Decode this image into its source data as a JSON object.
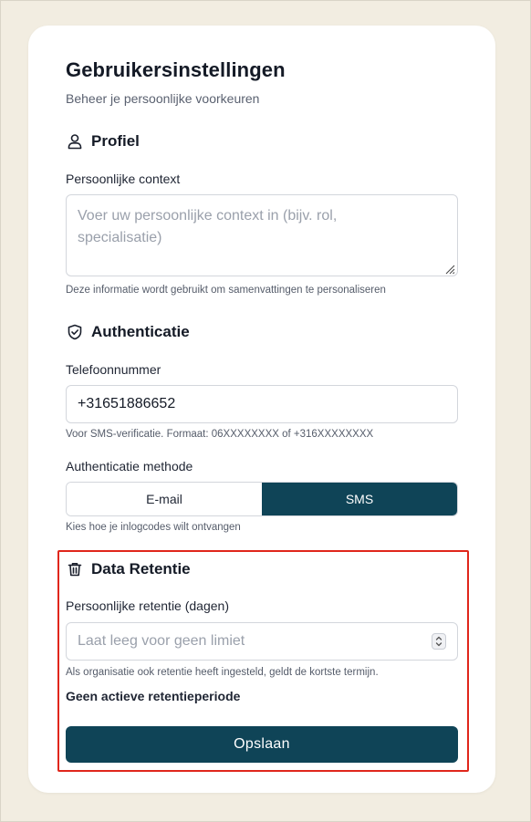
{
  "page": {
    "title": "Gebruikersinstellingen",
    "subtitle": "Beheer je persoonlijke voorkeuren"
  },
  "profile": {
    "heading": "Profiel",
    "icon": "user-icon",
    "context_label": "Persoonlijke context",
    "context_placeholder": "Voer uw persoonlijke context in (bijv. rol, specialisatie)",
    "context_value": "",
    "context_hint": "Deze informatie wordt gebruikt om samenvattingen te personaliseren"
  },
  "authentication": {
    "heading": "Authenticatie",
    "icon": "shield-check-icon",
    "phone_label": "Telefoonnummer",
    "phone_value": "+31651886652",
    "phone_hint": "Voor SMS-verificatie. Formaat: 06XXXXXXXX of +316XXXXXXXX",
    "method_label": "Authenticatie methode",
    "methods": [
      {
        "label": "E-mail",
        "selected": false
      },
      {
        "label": "SMS",
        "selected": true
      }
    ],
    "method_hint": "Kies hoe je inlogcodes wilt ontvangen"
  },
  "retention": {
    "heading": "Data Retentie",
    "icon": "trash-icon",
    "days_label": "Persoonlijke retentie (dagen)",
    "days_placeholder": "Laat leeg voor geen limiet",
    "days_value": "",
    "days_hint": "Als organisatie ook retentie heeft ingesteld, geldt de kortste termijn.",
    "status": "Geen actieve retentieperiode"
  },
  "actions": {
    "save_label": "Opslaan"
  },
  "colors": {
    "background": "#f2ede1",
    "card": "#ffffff",
    "primary": "#0f4457",
    "highlight": "#e0261b",
    "placeholder": "#9aa0ab"
  }
}
